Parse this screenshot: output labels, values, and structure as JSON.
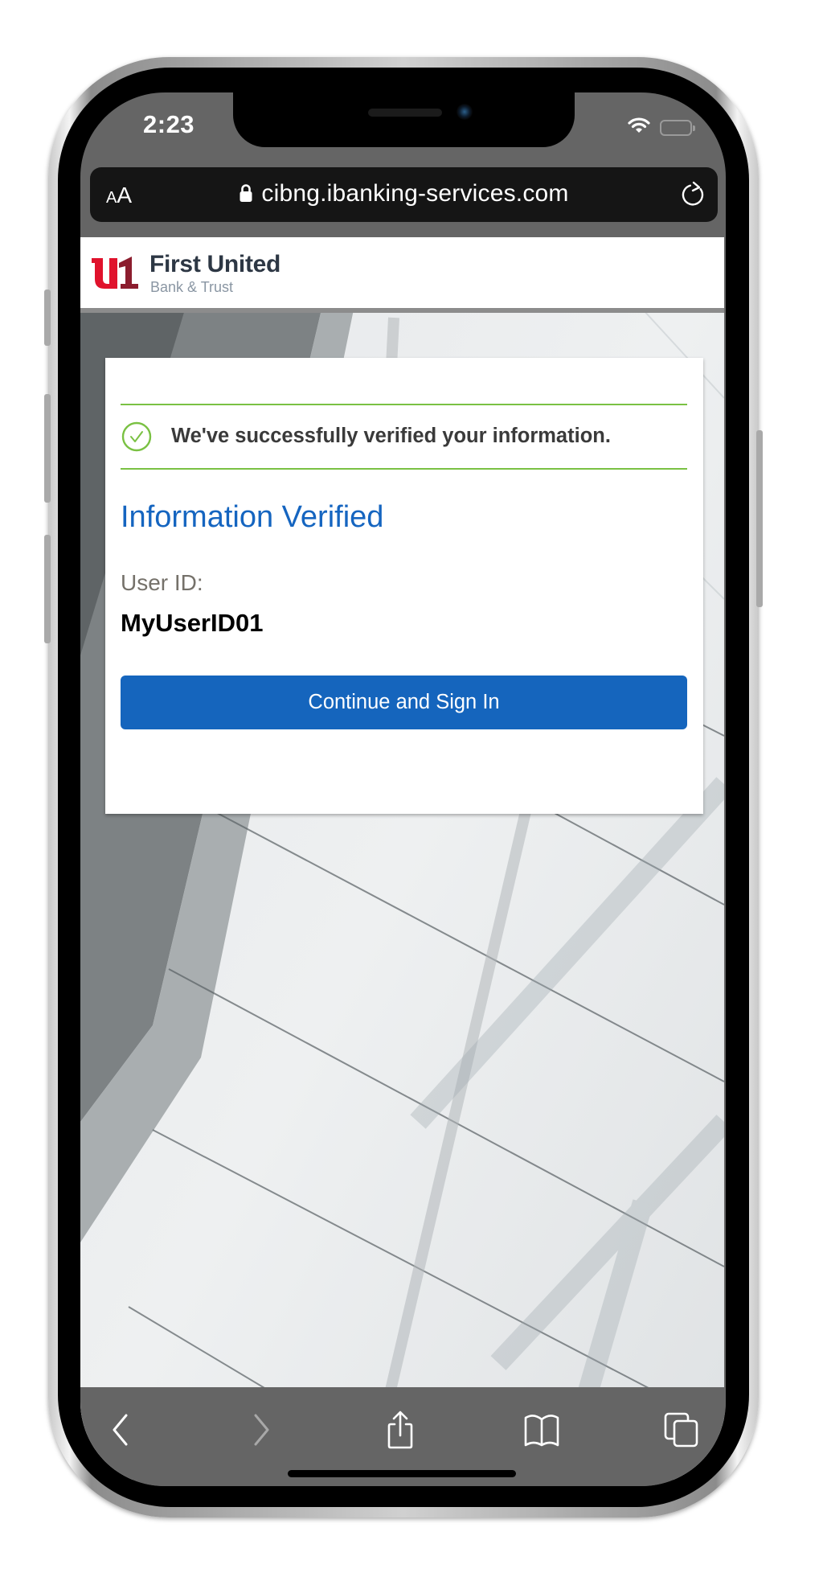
{
  "status_bar": {
    "time": "2:23",
    "icons": [
      "wifi-icon",
      "battery-icon"
    ]
  },
  "browser": {
    "text_size_label_small": "A",
    "text_size_label_large": "A",
    "url": "cibng.ibanking-services.com",
    "secure": true,
    "toolbar": {
      "buttons": [
        {
          "name": "back",
          "icon": "chevron-left-icon",
          "enabled": true
        },
        {
          "name": "forward",
          "icon": "chevron-right-icon",
          "enabled": false
        },
        {
          "name": "share",
          "icon": "share-icon",
          "enabled": true
        },
        {
          "name": "bookmarks",
          "icon": "book-icon",
          "enabled": true
        },
        {
          "name": "tabs",
          "icon": "tabs-icon",
          "enabled": true
        }
      ]
    }
  },
  "site": {
    "brand_name": "First United",
    "brand_sub": "Bank & Trust",
    "brand_colors": {
      "mark_left": "#e0122c",
      "mark_right": "#8c1d2e",
      "name": "#2d3744",
      "sub": "#8a96a3"
    }
  },
  "card": {
    "success_message": "We've successfully verified your information.",
    "title": "Information Verified",
    "userid_label": "User ID:",
    "userid_value": "MyUserID01",
    "continue_button": "Continue and Sign In"
  },
  "colors": {
    "accent_blue": "#1565bd",
    "success_green": "#7ac143",
    "title_blue": "#1565c0"
  }
}
